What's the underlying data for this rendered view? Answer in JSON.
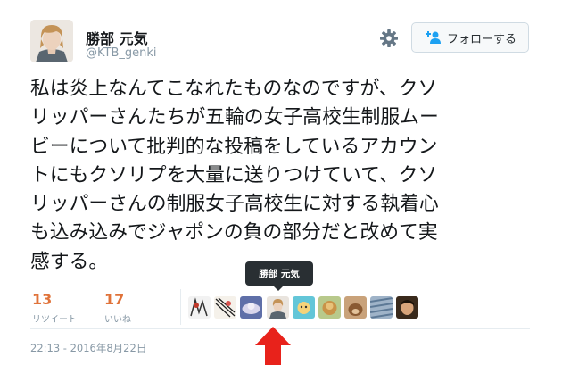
{
  "user": {
    "name": "勝部 元気",
    "handle": "@KTB_genki"
  },
  "follow_button": {
    "label": "フォローする"
  },
  "tweet_text": "私は炎上なんてこなれたものなのですが、クソ\nリッパーさんたちが五輪の女子高校生制服ムー\nビーについて批判的な投稿をしているアカウン\nトにもクソリプを大量に送りつけていて、クソ\nリッパーさんの制服女子高校生に対する執着心\nも込み込みでジャポンの負の部分だと改めて実\n感する。",
  "stats": {
    "retweets": {
      "count": "13",
      "label": "リツイート"
    },
    "likes": {
      "count": "17",
      "label": "いいね"
    }
  },
  "tooltip": "勝部 元気",
  "timestamp": "22:13 - 2016年8月22日",
  "colors": {
    "stat_number": "#e0733a",
    "follow_icon": "#1da1f2",
    "arrow": "#e8221b"
  },
  "icons": [
    "gear-icon",
    "person-plus-icon",
    "arrow-up-icon"
  ]
}
